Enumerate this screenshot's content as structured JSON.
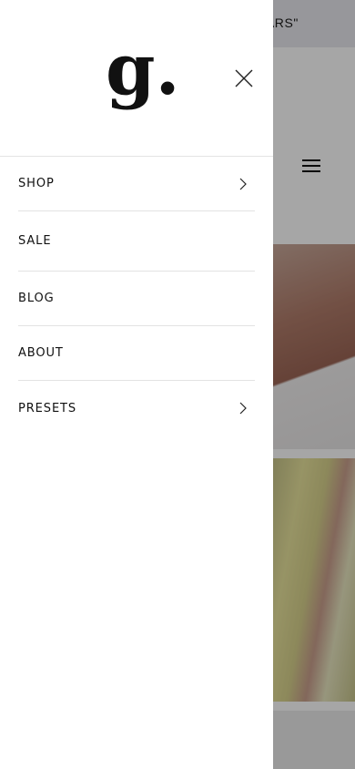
{
  "background": {
    "announcement_text": "ARS\""
  },
  "drawer": {
    "logo_text": "g.",
    "nav_items": [
      {
        "label": "SHOP",
        "has_submenu": true
      },
      {
        "label": "SALE",
        "has_submenu": false
      },
      {
        "label": "BLOG",
        "has_submenu": false
      },
      {
        "label": "ABOUT",
        "has_submenu": false
      },
      {
        "label": "PRESETS",
        "has_submenu": true
      }
    ]
  },
  "icons": {
    "close": "close-icon",
    "chevron": "chevron-right-icon",
    "menu": "hamburger-menu-icon"
  }
}
